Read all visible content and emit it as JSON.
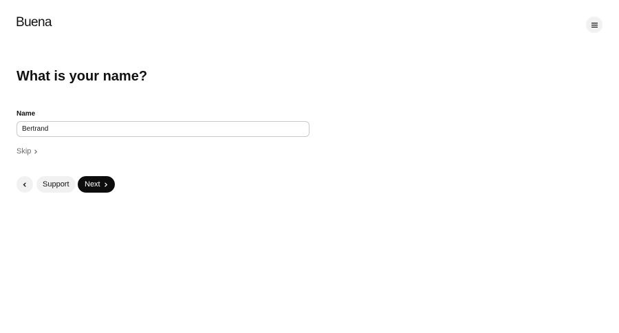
{
  "brand": {
    "name": "Buena"
  },
  "header": {
    "menu_icon": "hamburger-menu-icon"
  },
  "form": {
    "title": "What is your name?",
    "name_label": "Name",
    "name_value": "Bertrand",
    "skip_label": "Skip"
  },
  "actions": {
    "back_icon": "chevron-left-icon",
    "support_label": "Support",
    "next_label": "Next"
  },
  "colors": {
    "text": "#111111",
    "muted": "#6b6b6b",
    "button_bg": "#f1f1f1",
    "primary_bg": "#0d0d0d",
    "input_border": "#c9c9c9"
  }
}
